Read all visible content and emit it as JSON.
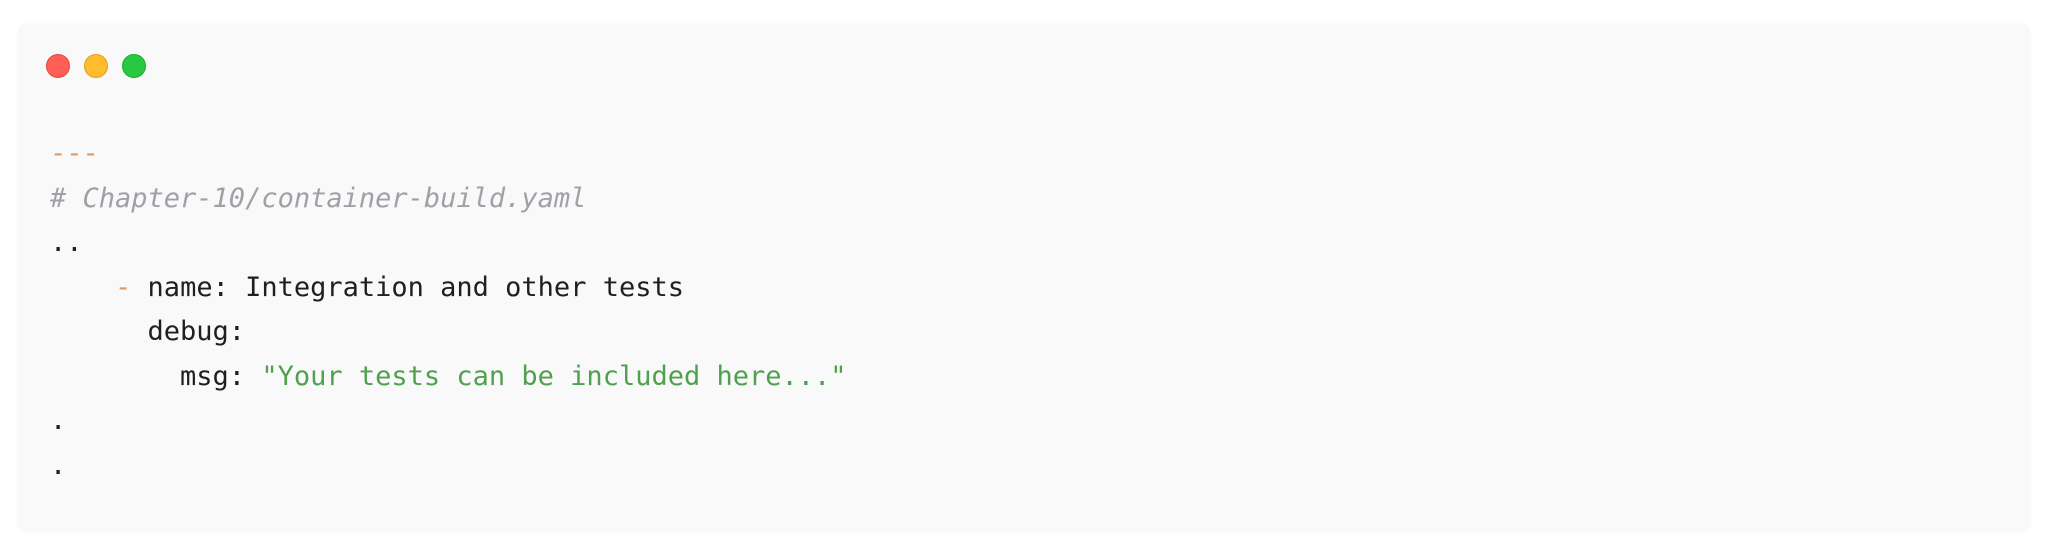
{
  "window": {
    "controls": [
      "close",
      "minimize",
      "zoom"
    ]
  },
  "code": {
    "line1": "---",
    "line2": "# Chapter-10/container-build.yaml",
    "line3": "..",
    "line4_indent": "    ",
    "line4_dash": "-",
    "line4_text": " name: Integration and other tests",
    "line5": "      debug:",
    "line6_key": "        msg: ",
    "line6_value": "\"Your tests can be included here...\"",
    "line7": ".",
    "line8": "."
  },
  "colors": {
    "background": "#f9f9f9",
    "comment": "#a0a1a7",
    "separator": "#e09a5f",
    "string": "#50a14f",
    "text": "#1f1f1f"
  }
}
